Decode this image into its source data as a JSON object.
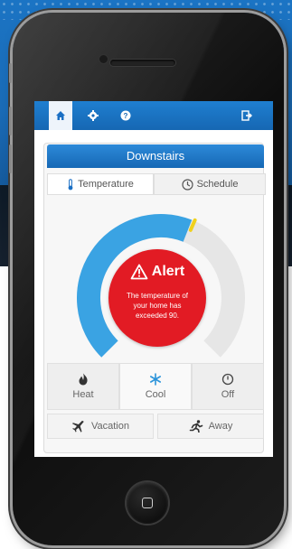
{
  "app": {
    "nav_tabs": [
      {
        "icon": "home-icon",
        "active": true
      },
      {
        "icon": "gear-icon",
        "active": false
      },
      {
        "icon": "help-icon",
        "active": false
      },
      {
        "icon": "logout-icon",
        "active": false
      }
    ]
  },
  "thermostat": {
    "zone_title": "Downstairs",
    "segments": [
      {
        "label": "Temperature",
        "icon": "thermometer-icon",
        "active": true
      },
      {
        "label": "Schedule",
        "icon": "clock-icon",
        "active": false
      }
    ],
    "dial": {
      "level": 0.58,
      "colors": {
        "active": "#3aa3e3",
        "track": "#e6e6e6",
        "marker": "#f0d11c"
      }
    },
    "alert": {
      "title": "Alert",
      "icon": "warning-icon",
      "message": "The temperature of your home has exceeded 90."
    },
    "modes": [
      {
        "label": "Heat",
        "icon": "flame-icon",
        "active": false
      },
      {
        "label": "Cool",
        "icon": "snowflake-icon",
        "active": true
      },
      {
        "label": "Off",
        "icon": "power-icon",
        "active": false
      }
    ],
    "presence": [
      {
        "label": "Vacation",
        "icon": "airplane-icon"
      },
      {
        "label": "Away",
        "icon": "running-icon"
      }
    ]
  },
  "colors": {
    "brand_blue": "#1a6fc4",
    "alert_red": "#e21b24"
  }
}
